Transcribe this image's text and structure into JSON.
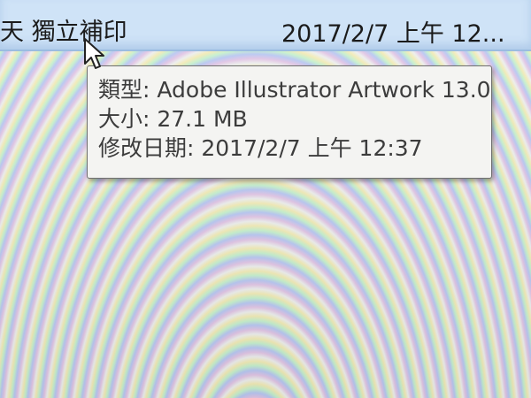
{
  "file_row": {
    "name": "天 獨立補印",
    "date": "2017/2/7 上午 12..."
  },
  "tooltip": {
    "type_line": "類型: Adobe Illustrator Artwork 13.0",
    "size_line": "大小: 27.1 MB",
    "modified_line": "修改日期: 2017/2/7 上午 12:37"
  },
  "colors": {
    "row_highlight": "#cfe3f7",
    "tooltip_bg": "#f4f4f2",
    "tooltip_border": "#707070"
  },
  "icons": {
    "cursor": "arrow-cursor-icon"
  }
}
